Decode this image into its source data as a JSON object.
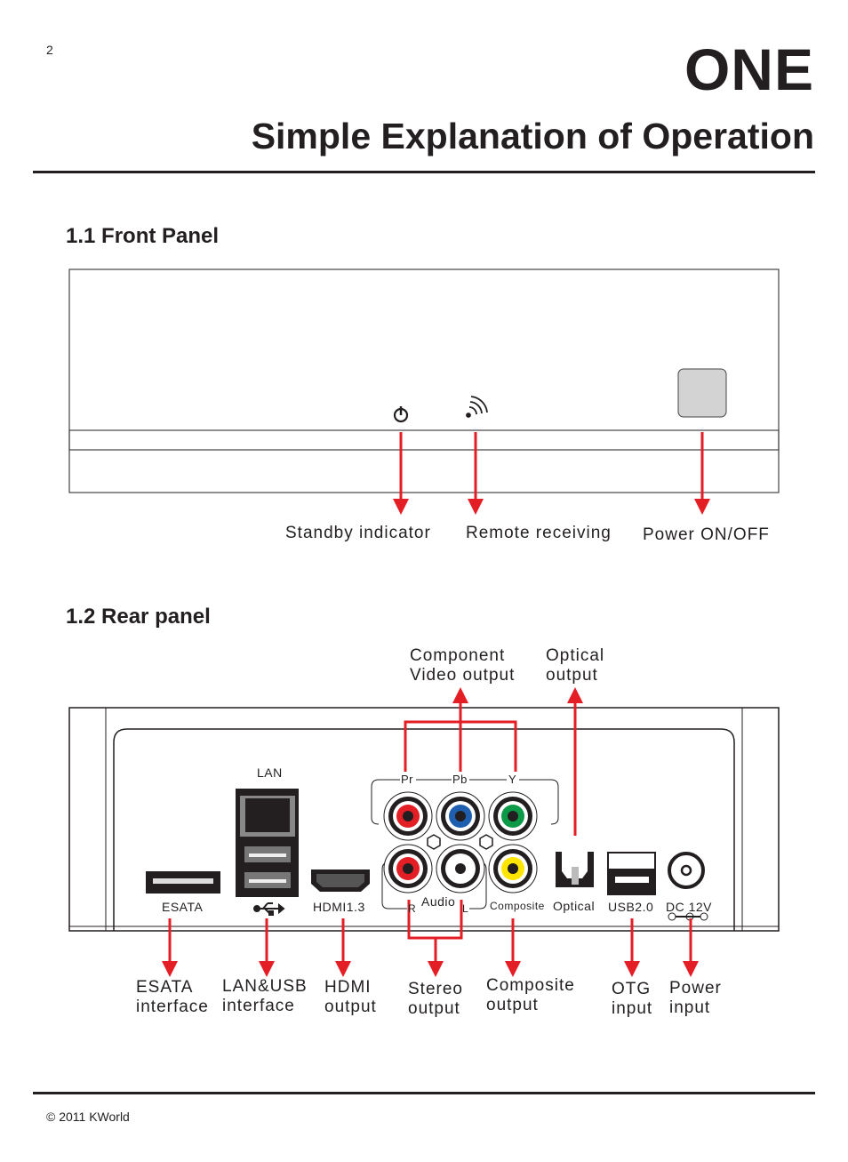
{
  "page_number": "2",
  "chapter": {
    "number": "ONE",
    "title": "Simple Explanation of Operation"
  },
  "front_panel": {
    "heading": "1.1 Front Panel",
    "callouts": [
      "Standby indicator",
      "Remote receiving",
      "Power ON/OFF"
    ],
    "icons": [
      "power-icon",
      "remote-signal-icon",
      "power-button"
    ]
  },
  "rear_panel": {
    "heading": "1.2 Rear panel",
    "top_callouts": {
      "component": [
        "Component",
        "Video output"
      ],
      "optical": [
        "Optical",
        "output"
      ]
    },
    "port_labels": {
      "lan": "LAN",
      "esata": "ESATA",
      "hdmi": "HDMI1.3",
      "pr": "Pr",
      "pb": "Pb",
      "y": "Y",
      "audio": "Audio",
      "r": "R",
      "l": "L",
      "composite": "Composite",
      "optical": "Optical",
      "usb": "USB2.0",
      "dc": "DC 12V"
    },
    "bottom_callouts": [
      [
        "ESATA",
        "interface"
      ],
      [
        "LAN&USB",
        "interface"
      ],
      [
        "HDMI",
        "output"
      ],
      [
        "Stereo",
        "output"
      ],
      [
        "Composite",
        "output"
      ],
      [
        "OTG",
        "input"
      ],
      [
        "Power",
        "input"
      ]
    ]
  },
  "colors": {
    "arrow": "#e31e24",
    "pr": "#e31e24",
    "pb": "#1f5fb0",
    "y": "#0d9a48",
    "composite": "#ffe600",
    "button": "#d3d3d3"
  },
  "footer": "© 2011 KWorld"
}
